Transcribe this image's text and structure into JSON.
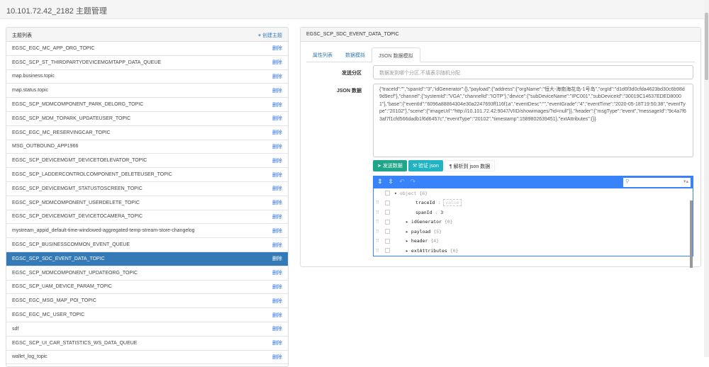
{
  "title": "10.101.72.42_2182 主题管理",
  "list": {
    "header": "主题列表",
    "create_label": "创建主题",
    "delete_label": "删除",
    "items": [
      "EGSC_EGC_MC_APP_ORG_TOPIC",
      "EGSC_SCP_ST_THIRDPARTYDEVICEMGMTAPP_DATA_QUEUE",
      "map.business.topic",
      "map.status.topic",
      "EGSC_SCP_MDMCOMPONENT_PARK_DELORG_TOPIC",
      "EGSC_SCP_MDM_TOPARK_UPDATEUSER_TOPIC",
      "EGSC_EGC_MC_RESERVINGCAR_TOPIC",
      "MSG_OUTBOUND_APP1966",
      "EGSC_SCP_DEVICEMGMT_DEVICETOELEVATOR_TOPIC",
      "EGSC_SCP_LADDERCONTROLCOMPONENT_DELETEUSER_TOPIC",
      "EGSC_SCP_DEVICEMGMT_STATUSTOSCREEN_TOPIC",
      "EGSC_SCP_MDMCOMPONENT_USERDELETE_TOPIC",
      "EGSC_SCP_DEVICEMGMT_DEVICETOCAMERA_TOPIC",
      "mystream_appid_default-time-windowed-aggregated-temp-stream-store-changelog",
      "EGSC_SCP_BUSINESSCOMMON_EVENT_QUEUE",
      "EGSC_SCP_SDC_EVENT_DATA_TOPIC",
      "EGSC_SCP_MDMCOMPONENT_UPDATEORG_TOPIC",
      "EGSC_SCP_UAM_DEVICE_PARAM_TOPIC",
      "EGSC_EGC_MSG_MAP_POI_TOPIC",
      "EGSC_EGC_MC_USER_TOPIC",
      "sdf",
      "EGSC_SCP_UI_CAR_STATISTICS_WS_DATA_QUEUE",
      "wallet_log_topic"
    ],
    "selected_index": 15
  },
  "detail": {
    "header": "EGSC_SCP_SDC_EVENT_DATA_TOPIC",
    "tabs": [
      "属性列表",
      "数据模拟",
      "JSON 数据模拟"
    ],
    "partition_label": "发送分区",
    "partition_placeholder": "数据发到哪个分区,不填表示随机分配",
    "json_label": "JSON 数据",
    "json_value": "{\"traceId\":\"\",\"spanId\":\"3\",\"idGenerator\":{},\"payload\":{\"address\":{\"orgName\":\"恒大-海南海花岛-1号岛\",\"orgId\":\"d1d6f3d0cfda4623bd30c6b98d9d9ecf\"},\"channel\":{\"systemId\":\"VGA\",\"channelId\":\"IOTP\"},\"device\":{\"subDeviceName\":\"IPC001\",\"subDeviceId\":\"30019C14637EDED80001\"},\"base\":{\"eventId\":\"6096a88864304e30a2247693ff116f1a\",\"eventDesc\":\"\",\"eventGrade\":\"4\",\"eventTime\":\"2020-05-18T19:50:38\",\"eventType\":\"20102\"},\"scene\":{\"imageUrl\":\"http://10.101.72.42:9047/VIID/showimages/?id=null\"}},\"header\":{\"msgType\":\"event\",\"messageId\":\"9c4a7f63af7f1cfd566dadb1f6d6457c\",\"eventType\":\"20102\",\"timestamp\":1589802639451},\"extAttributes\":{}}",
    "buttons": {
      "send": "发送数据",
      "validate": "验证 json",
      "parse": "解析到 json 数据"
    },
    "tree": {
      "root": "object",
      "root_count": "{6}",
      "value_placeholder": "value",
      "nodes": [
        {
          "key": "traceId",
          "value": ""
        },
        {
          "key": "spanId",
          "value": "3"
        },
        {
          "key": "idGenerator",
          "meta": "{0}"
        },
        {
          "key": "payload",
          "meta": "{5}"
        },
        {
          "key": "header",
          "meta": "{4}"
        },
        {
          "key": "extAttributes",
          "meta": "{0}"
        }
      ]
    }
  }
}
